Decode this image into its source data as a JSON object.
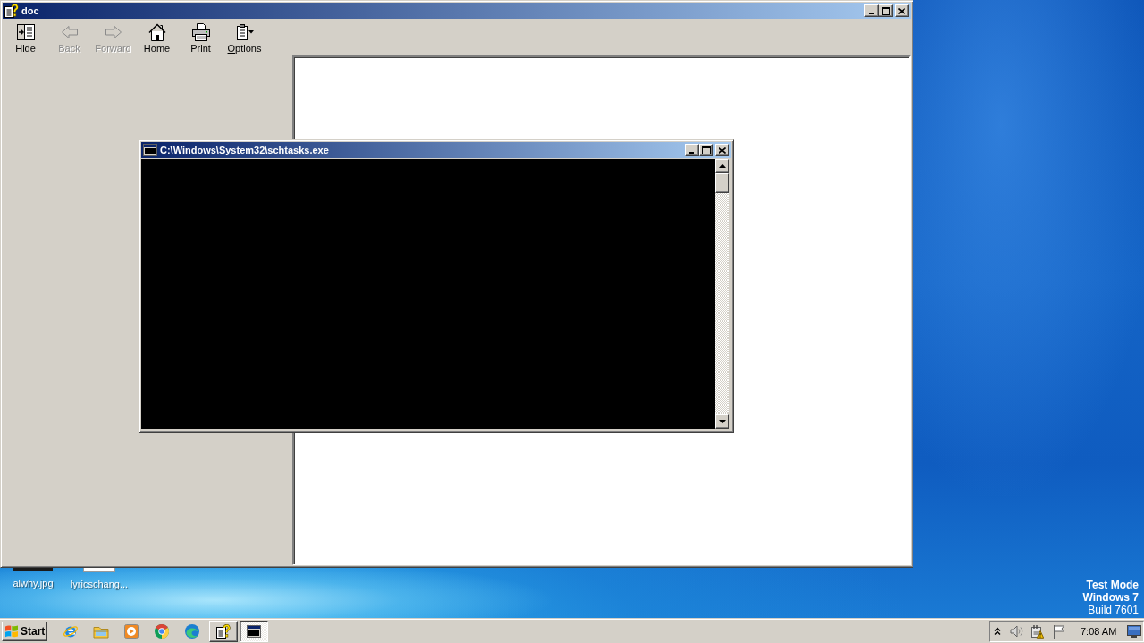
{
  "desktop": {
    "icons": [
      {
        "label": "alwhy.jpg",
        "kind": "photo"
      },
      {
        "label": "lyricschang...",
        "kind": "document"
      }
    ],
    "notice": {
      "mode": "Test Mode",
      "edition": "Windows 7",
      "build": "Build 7601"
    }
  },
  "help_window": {
    "title": "doc",
    "toolbar": [
      {
        "label": "Hide",
        "kind": "hide",
        "disabled": false,
        "accelerator": false
      },
      {
        "label": "Back",
        "kind": "back",
        "disabled": true,
        "accelerator": false
      },
      {
        "label": "Forward",
        "kind": "forward",
        "disabled": true,
        "accelerator": false
      },
      {
        "label": "Home",
        "kind": "home",
        "disabled": false,
        "accelerator": false
      },
      {
        "label": "Print",
        "kind": "print",
        "disabled": false,
        "accelerator": false
      },
      {
        "label": "Options",
        "kind": "options",
        "disabled": false,
        "accelerator": true
      }
    ]
  },
  "console_window": {
    "title": "C:\\Windows\\System32\\schtasks.exe"
  },
  "taskbar": {
    "start": "Start",
    "pinned": [
      {
        "kind": "globe"
      },
      {
        "kind": "folder"
      },
      {
        "kind": "player"
      },
      {
        "kind": "ring"
      },
      {
        "kind": "wave"
      }
    ],
    "tasks": [
      {
        "kind": "help",
        "selected": false
      },
      {
        "kind": "console",
        "selected": true
      }
    ],
    "clock": "7:08 AM"
  }
}
